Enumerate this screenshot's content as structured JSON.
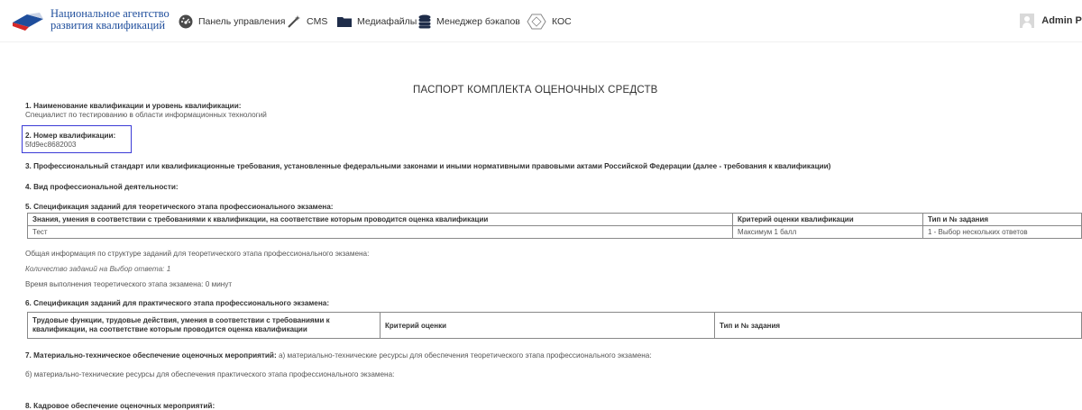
{
  "header": {
    "logo_line1": "Национальное агентство",
    "logo_line2": "развития квалификаций",
    "nav": [
      {
        "label": "Панель управления",
        "icon": "dashboard-icon"
      },
      {
        "label": "CMS",
        "icon": "magic-wand-icon"
      },
      {
        "label": "Медиафайлы",
        "icon": "folder-icon"
      },
      {
        "label": "Менеджер бэкапов",
        "icon": "database-icon"
      },
      {
        "label": "КОС",
        "icon": "hexagon-icon"
      }
    ],
    "user_name": "Admin Pe"
  },
  "doc": {
    "title": "ПАСПОРТ КОМПЛЕКТА ОЦЕНОЧНЫХ СРЕДСТВ",
    "s1_label": "1. Наименование квалификации и уровень квалификации:",
    "s1_value": "Специалист по тестированию в области информационных технологий",
    "s2_label": "2. Номер квалификации:",
    "s2_value": "5fd9ec8682003",
    "s3_label": "3. Профессиональный стандарт или квалификационные требования, установленные федеральными законами и иными нормативными правовыми актами Российской Федерации (далее - требования к квалификации)",
    "s4_label": "4. Вид профессиональной деятельности:",
    "s5_label": "5. Спецификация заданий для теоретического этапа профессионального экзамена:",
    "t1": {
      "headers": [
        "Знания, умения в соответствии с требованиями к квалификации, на соответствие которым проводится оценка квалификации",
        "Критерий оценки квалификации",
        "Тип и № задания"
      ],
      "row": [
        "Тест",
        "Максимум 1 балл",
        "1 - Выбор нескольких ответов"
      ]
    },
    "s5_info": "Общая информация по структуре заданий для теоретического этапа профессионального экзамена:",
    "s5_count": "Количество заданий на Выбор ответа: 1",
    "s5_time": "Время выполнения теоретического этапа экзамена: 0 минут",
    "s6_label": "6. Спецификация заданий для практического этапа профессионального экзамена:",
    "t2": {
      "h1_line1": "Трудовые функции, трудовые действия, умения в соответствии с требованиями к",
      "h1_line2": "квалификации, на соответствие которым проводится оценка квалификации",
      "h2": "Критерий оценки",
      "h3": "Тип и № задания"
    },
    "s7_label": "7. Материально-техническое обеспечение оценочных мероприятий:",
    "s7_a": " а) материально-технические ресурсы для обеспечения теоретического этапа профессионального экзамена:",
    "s7_b": "б) материально-технические ресурсы для обеспечения практического этапа профессионального экзамена:",
    "s8_label": "8. Кадровое обеспечение оценочных мероприятий:"
  },
  "colors": {
    "brand_blue": "#1f4e9c",
    "brand_red": "#d62828",
    "highlight": "#3b3bd6"
  }
}
